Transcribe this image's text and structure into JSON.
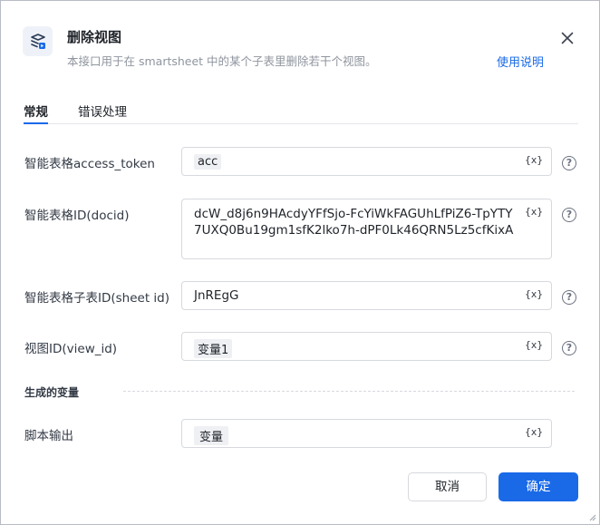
{
  "header": {
    "title": "删除视图",
    "subtitle": "本接口用于在 smartsheet 中的某个子表里删除若干个视图。",
    "help_link": "使用说明"
  },
  "tabs": [
    {
      "label": "常规",
      "active": true
    },
    {
      "label": "错误处理",
      "active": false
    }
  ],
  "fields": {
    "access_token": {
      "label": "智能表格access_token",
      "value": "acc"
    },
    "docid": {
      "label": "智能表格ID(docid)",
      "value": "dcW_d8j6n9HAcdyYFfSjo-FcYiWkFAGUhLfPiZ6-TpYTY7UXQ0Bu19gm1sfK2lko7h-dPF0Lk46QRN5Lz5cfKixA"
    },
    "sheet_id": {
      "label": "智能表格子表ID(sheet id)",
      "value": "JnREgG"
    },
    "view_id": {
      "label": "视图ID(view_id)",
      "value": "变量1"
    }
  },
  "output_section": {
    "title": "生成的变量",
    "script_output": {
      "label": "脚本输出",
      "value": "变量"
    }
  },
  "variable_icon_text": "{x}",
  "help_icon_text": "?",
  "footer": {
    "cancel_label": "取消",
    "ok_label": "确定"
  },
  "colors": {
    "accent": "#1a6ae8",
    "border": "#d6d9de",
    "chip_bg": "#eef0f3"
  }
}
